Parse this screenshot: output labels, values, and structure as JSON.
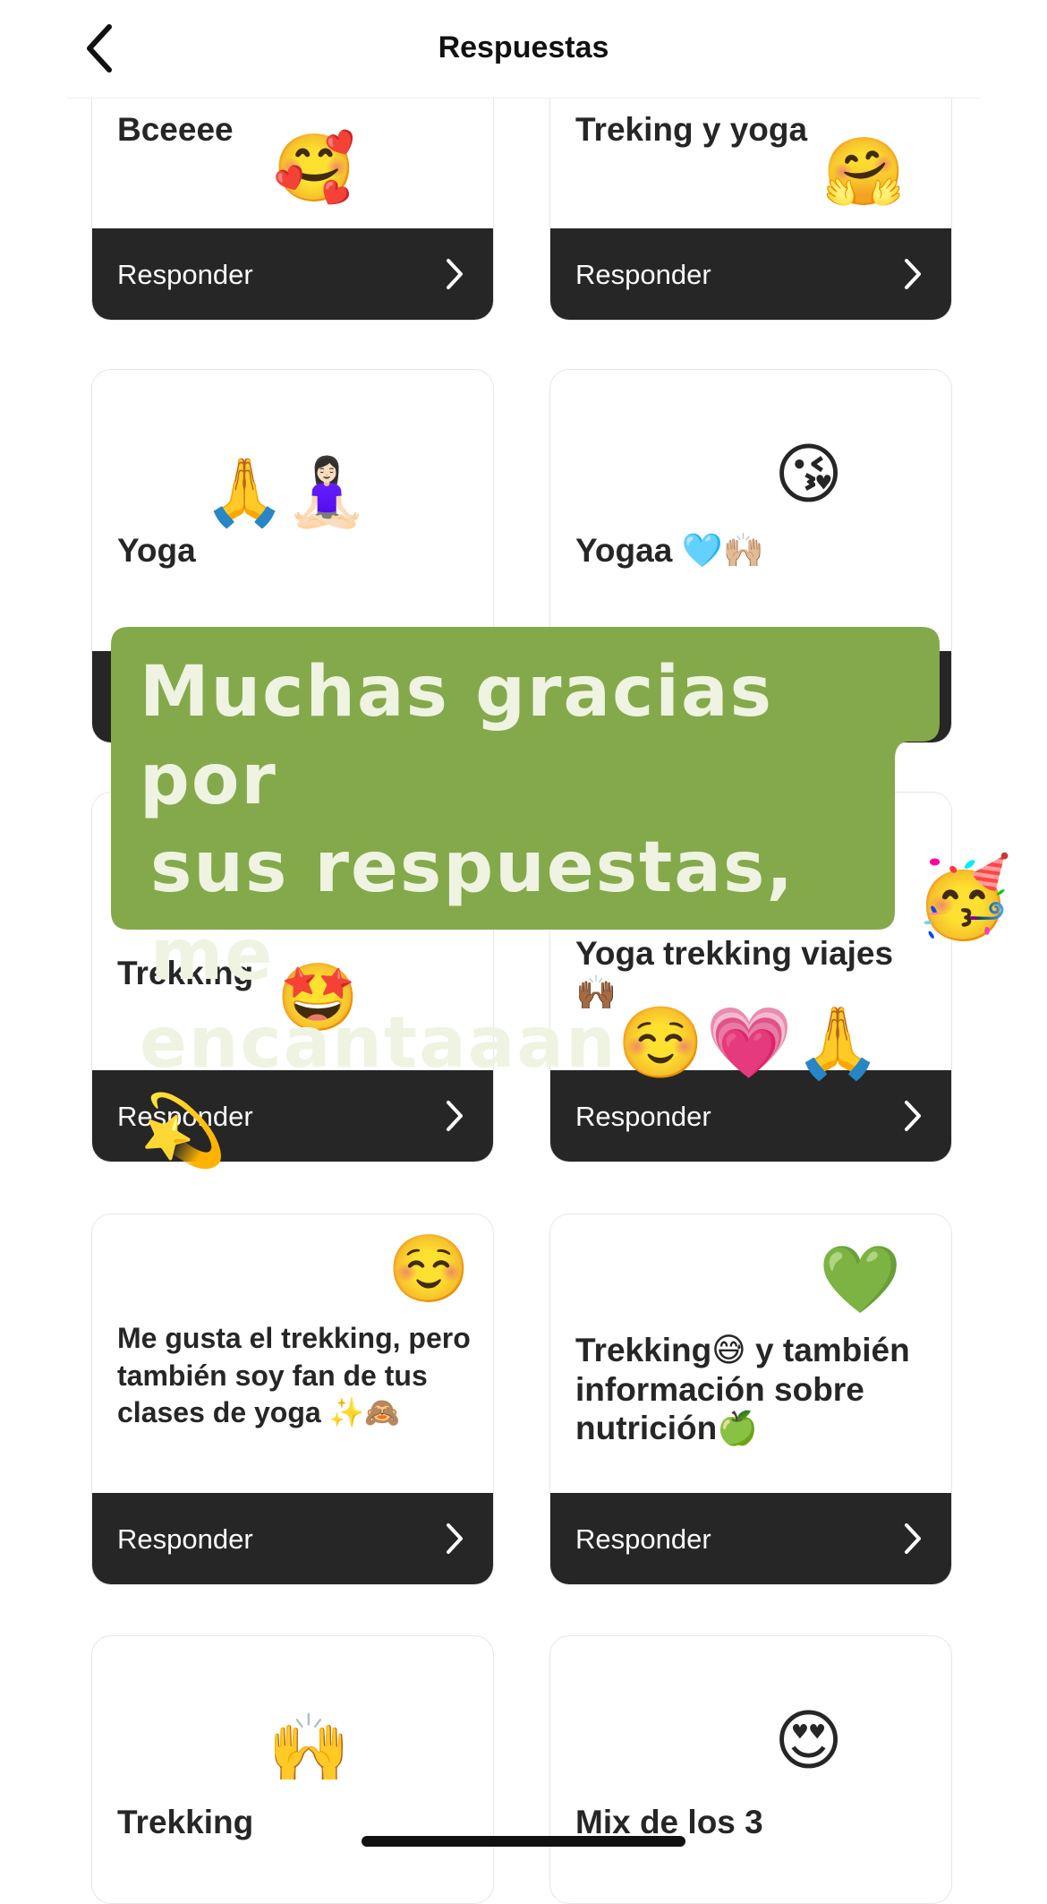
{
  "header": {
    "title": "Respuestas",
    "back_icon": "chevron-left-icon"
  },
  "reply_label": "Responder",
  "cards": [
    {
      "text": "Bceeee",
      "emoji": "🥰"
    },
    {
      "text": "Treking y yoga",
      "emoji": "🤗"
    },
    {
      "text": "Yoga",
      "emoji": "🙏🧘🏻‍♀️"
    },
    {
      "text": "Yogaa 🩵🙌🏼",
      "emoji": "😘"
    },
    {
      "text": "Trekking",
      "emoji": "🤩"
    },
    {
      "text": "Yoga trekking viajes 🙌🏾",
      "emoji": ""
    },
    {
      "text": "Me gusta el trekking, pero también soy fan de tus clases de yoga ✨🙈",
      "emoji": "☺️"
    },
    {
      "text": "Trekking😅 y también información sobre nutrición🍏",
      "emoji": "💚"
    },
    {
      "text": "Trekking",
      "emoji": "🙌"
    },
    {
      "text": "Mix de los 3",
      "emoji": "😍"
    }
  ],
  "sticker": {
    "line1": "Muchas gracias por",
    "line2": "sus respuestas, me",
    "line3": "encantaaan☺️💗🙏💫",
    "party_emoji": "🥳",
    "color": "#84a94a"
  }
}
